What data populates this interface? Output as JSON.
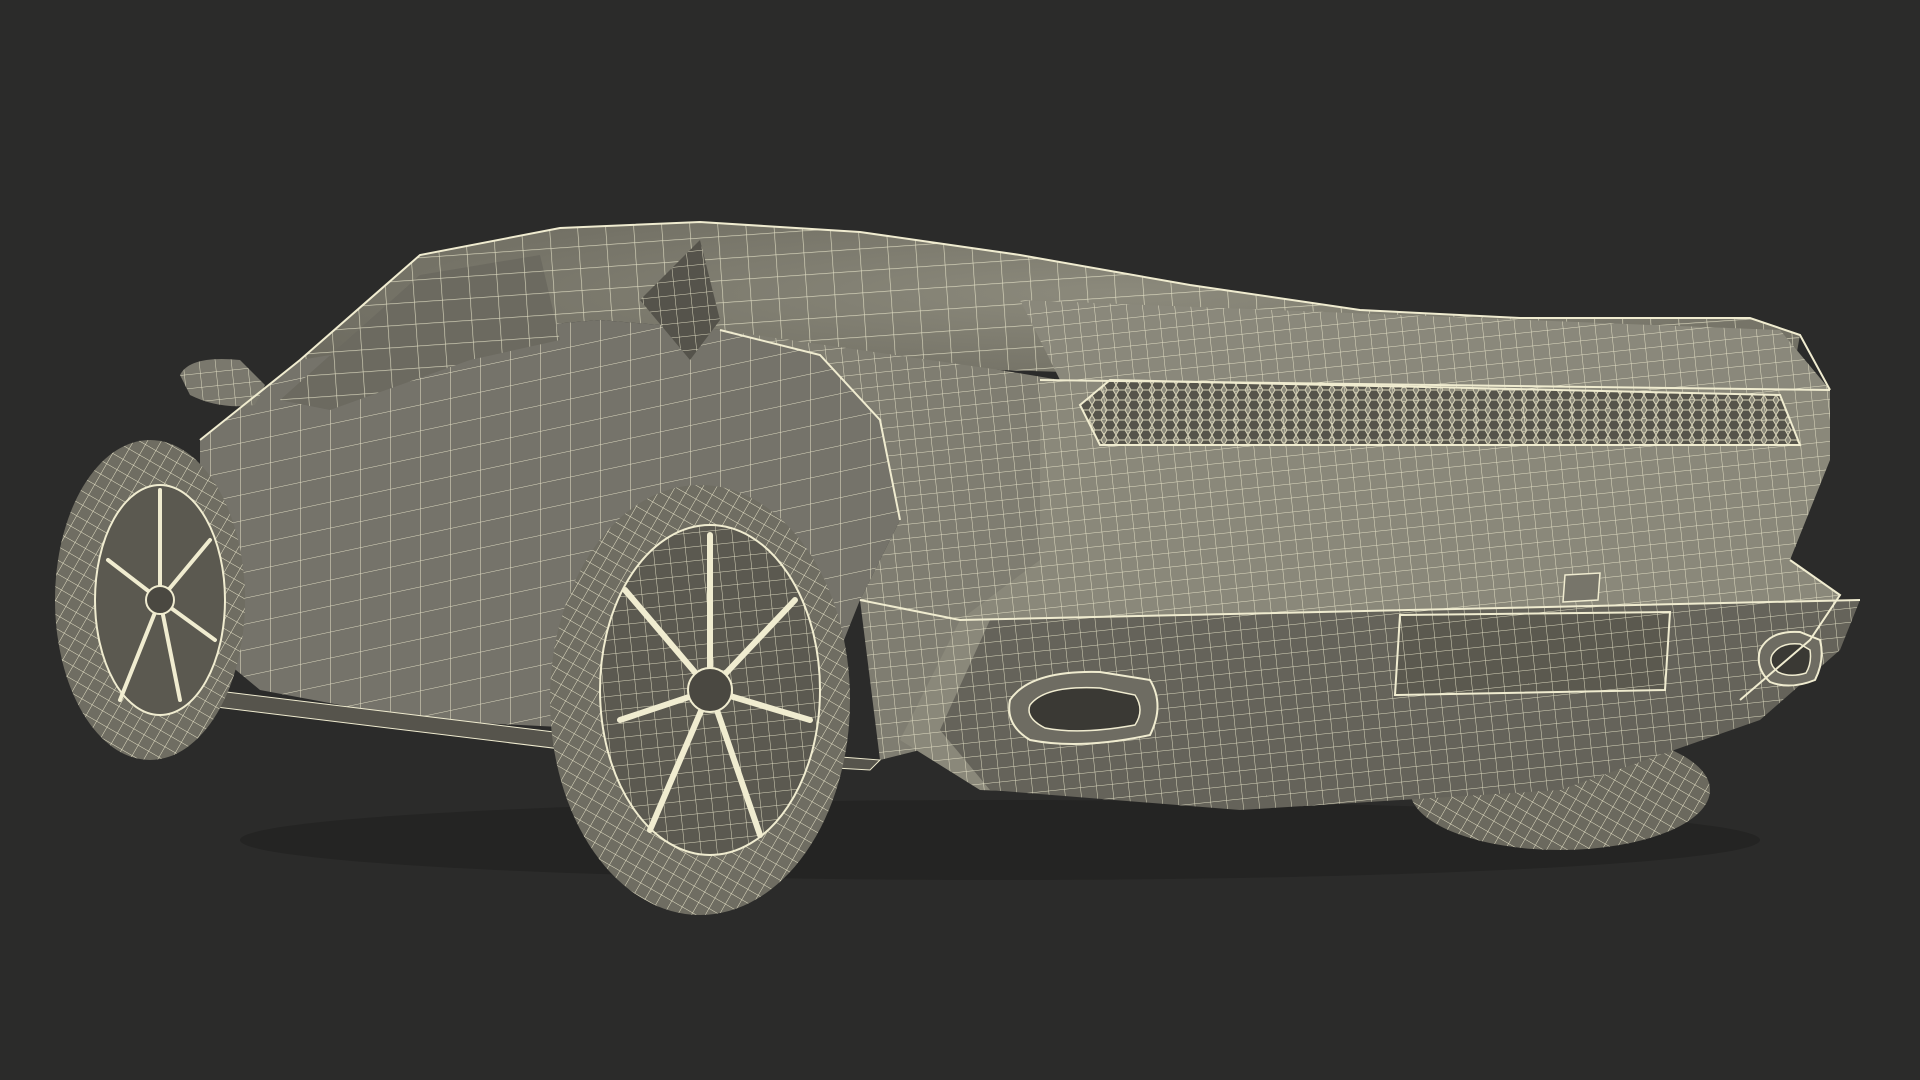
{
  "scene": {
    "subject": "sports-car-wireframe-rear-three-quarter",
    "colors": {
      "background": "#2b2b2a",
      "surface": "#7d7b6e",
      "surface_light": "#a3a193",
      "surface_dark": "#4e4c44",
      "shadow": "#3a3934",
      "wire": "#f0ecd0",
      "wire_dim": "#cfcab0"
    }
  }
}
